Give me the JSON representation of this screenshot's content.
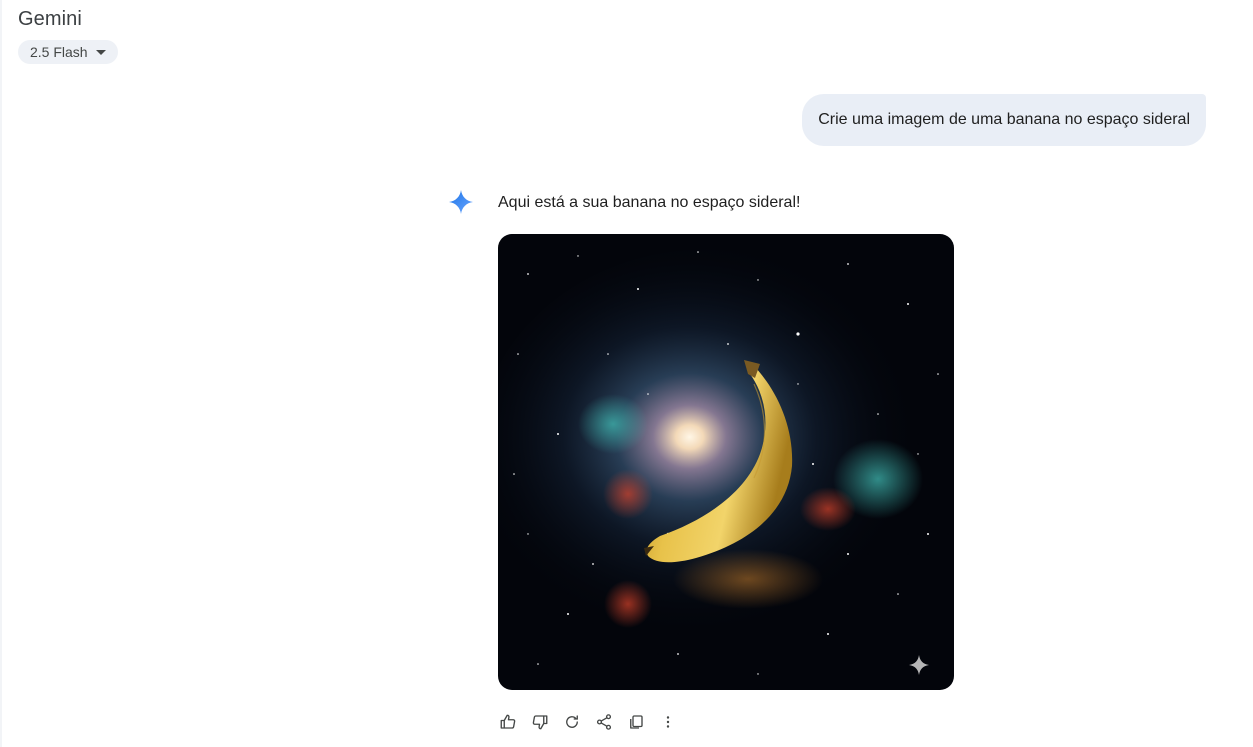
{
  "header": {
    "app_title": "Gemini",
    "model_label": "2.5 Flash"
  },
  "conversation": {
    "user_prompt": "Crie uma imagem de uma banana no espaço sideral",
    "assistant_reply": "Aqui está a sua banana no espaço sideral!"
  },
  "response_actions": [
    {
      "icon": "thumbs-up-icon"
    },
    {
      "icon": "thumbs-down-icon"
    },
    {
      "icon": "redo-icon"
    },
    {
      "icon": "share-icon"
    },
    {
      "icon": "copy-icon"
    },
    {
      "icon": "more-vert-icon"
    }
  ],
  "colors": {
    "accent": "#4285f4",
    "user_bubble": "#e9eef6",
    "chip": "#eef1f6"
  }
}
